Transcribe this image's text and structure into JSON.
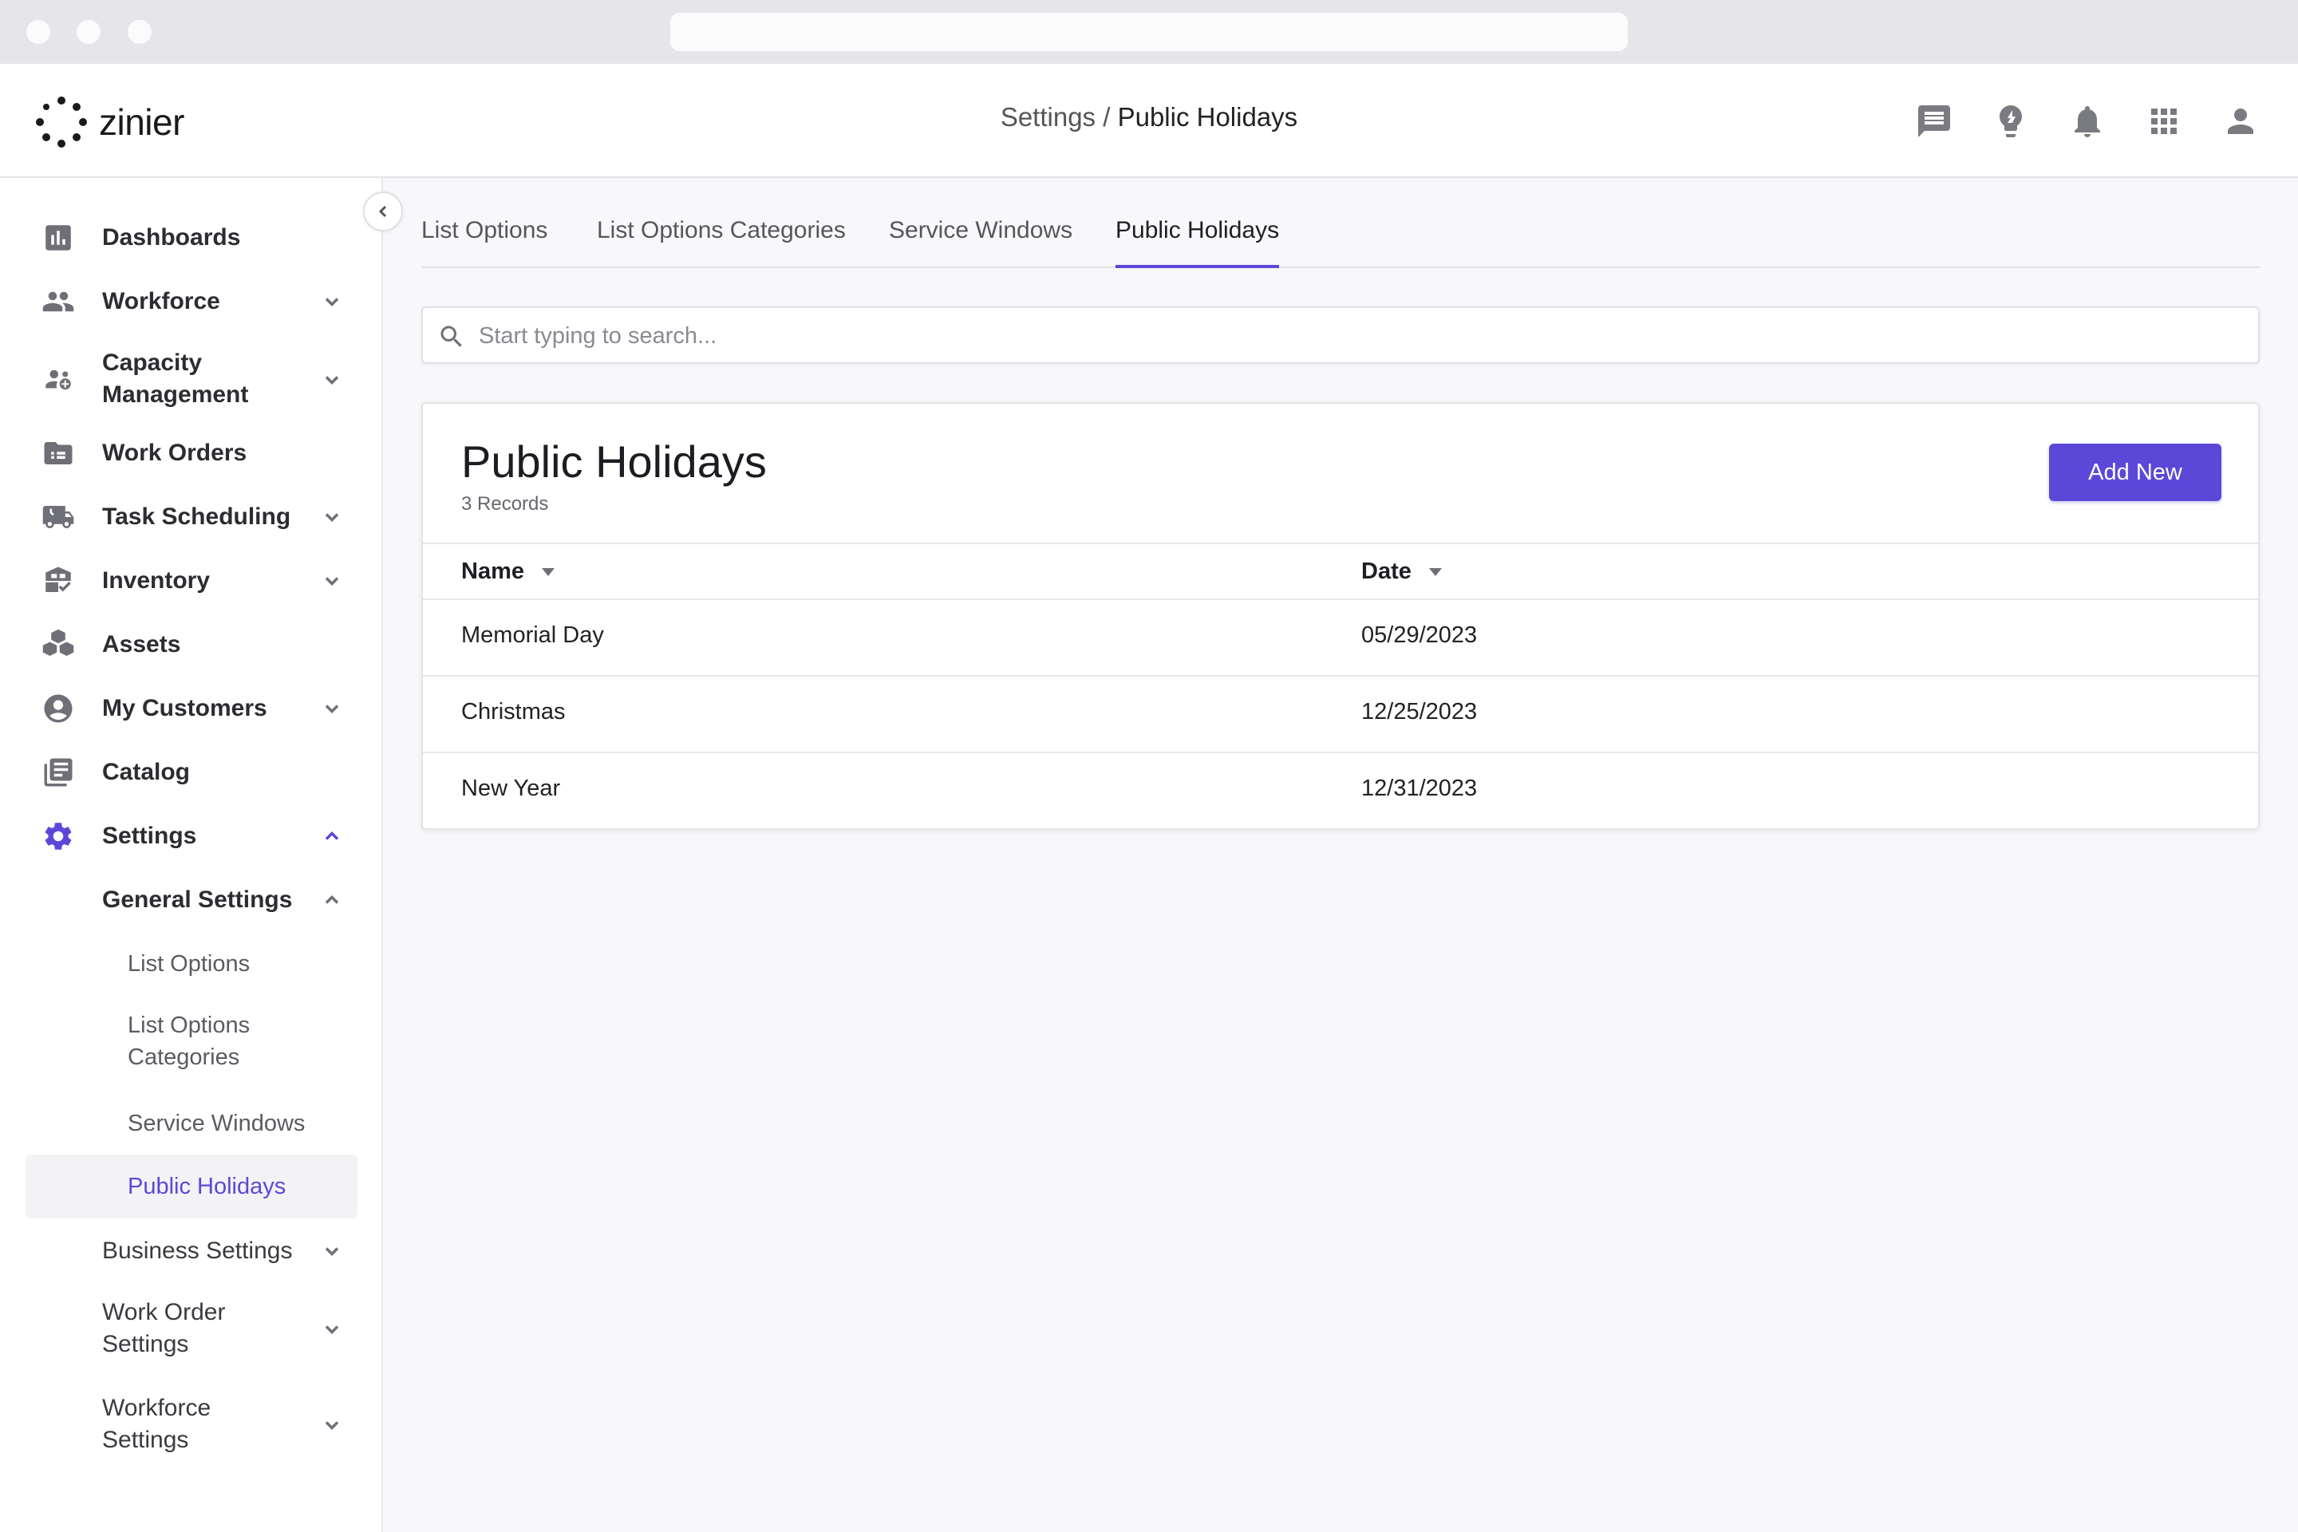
{
  "logo": {
    "text": "zinier"
  },
  "breadcrumb": {
    "parent": "Settings",
    "separator": " / ",
    "current": "Public Holidays"
  },
  "header_icons": [
    "chat-icon",
    "lightbulb-icon",
    "bell-icon",
    "apps-grid-icon",
    "user-icon"
  ],
  "sidebar": {
    "items": [
      {
        "label": "Dashboards",
        "icon": "dashboard-icon"
      },
      {
        "label": "Workforce",
        "icon": "people-icon"
      },
      {
        "label": "Capacity Management",
        "line1": "Capacity",
        "line2": "Management",
        "icon": "capacity-icon"
      },
      {
        "label": "Work Orders",
        "icon": "work-orders-icon"
      },
      {
        "label": "Task Scheduling",
        "icon": "truck-icon"
      },
      {
        "label": "Inventory",
        "icon": "inventory-icon"
      },
      {
        "label": "Assets",
        "icon": "assets-icon"
      },
      {
        "label": "My Customers",
        "icon": "customer-icon"
      },
      {
        "label": "Catalog",
        "icon": "catalog-icon"
      },
      {
        "label": "Settings",
        "icon": "gear-icon"
      }
    ],
    "general_settings": "General Settings",
    "sub_items": [
      {
        "label": "List Options"
      },
      {
        "label": "List Options Categories",
        "line1": "List Options",
        "line2": "Categories"
      },
      {
        "label": "Service Windows"
      },
      {
        "label": "Public Holidays"
      }
    ],
    "business_settings": "Business Settings",
    "work_order_settings": {
      "line1": "Work Order",
      "line2": "Settings"
    },
    "workforce_settings": {
      "line1": "Workforce",
      "line2": "Settings"
    }
  },
  "tabs": [
    {
      "label": "List Options"
    },
    {
      "label": "List Options Categories"
    },
    {
      "label": "Service Windows"
    },
    {
      "label": "Public Holidays",
      "active": true
    }
  ],
  "search": {
    "placeholder": "Start typing to search...",
    "value": ""
  },
  "card": {
    "title": "Public Holidays",
    "count": "3 Records",
    "add_label": "Add New",
    "columns": [
      "Name",
      "Date"
    ],
    "rows": [
      {
        "name": "Memorial Day",
        "date": "05/29/2023"
      },
      {
        "name": "Christmas",
        "date": "12/25/2023"
      },
      {
        "name": "New Year",
        "date": "12/31/2023"
      }
    ]
  },
  "colors": {
    "accent": "#5b48d9",
    "icon": "#6f6f78",
    "background": "#f8f8fa"
  }
}
